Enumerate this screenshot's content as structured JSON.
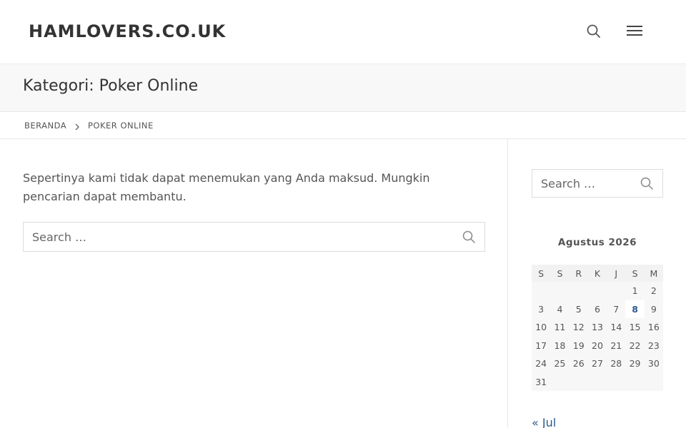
{
  "header": {
    "site_title": "HAMLOVERS.CO.UK",
    "search_icon": "search-icon",
    "menu_icon": "hamburger-menu-icon"
  },
  "title_bar": {
    "page_title": "Kategori: Poker Online"
  },
  "breadcrumb": {
    "home": "BERANDA",
    "separator_icon": "chevron-right-icon",
    "current": "POKER ONLINE"
  },
  "main": {
    "not_found_text": "Sepertinya kami tidak dapat menemukan yang Anda maksud. Mungkin pencarian dapat membantu.",
    "search_placeholder": "Search …"
  },
  "sidebar": {
    "search_placeholder": "Search …",
    "calendar": {
      "caption": "Agustus 2026",
      "weekdays": [
        "S",
        "S",
        "R",
        "K",
        "J",
        "S",
        "M"
      ],
      "weeks": [
        [
          "",
          "",
          "",
          "",
          "",
          "1",
          "2"
        ],
        [
          "3",
          "4",
          "5",
          "6",
          "7",
          "8",
          "9"
        ],
        [
          "10",
          "11",
          "12",
          "13",
          "14",
          "15",
          "16"
        ],
        [
          "17",
          "18",
          "19",
          "20",
          "21",
          "22",
          "23"
        ],
        [
          "24",
          "25",
          "26",
          "27",
          "28",
          "29",
          "30"
        ],
        [
          "31",
          "",
          "",
          "",
          "",
          "",
          ""
        ]
      ],
      "linked_day": "8",
      "prev_link": "« Jul"
    }
  },
  "colors": {
    "link": "#2c5a8c",
    "title_bar_bg": "#f8f8f8",
    "text": "#555555"
  }
}
